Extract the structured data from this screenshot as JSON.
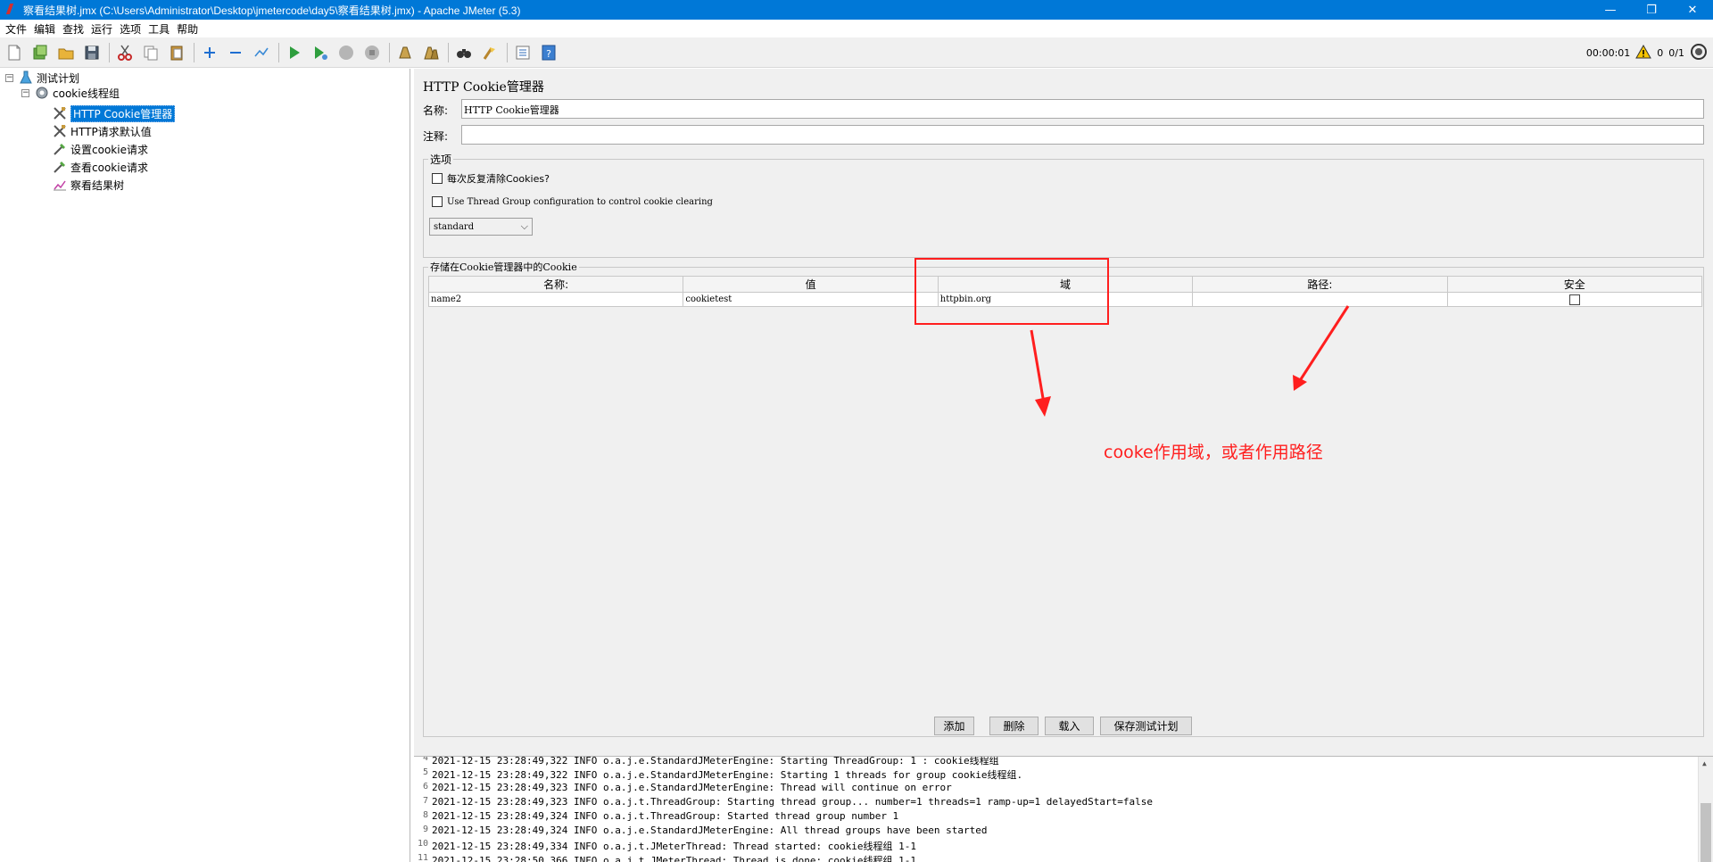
{
  "window": {
    "title": "察看结果树.jmx (C:\\Users\\Administrator\\Desktop\\jmetercode\\day5\\察看结果树.jmx) - Apache JMeter (5.3)",
    "minimize": "—",
    "maximize": "❐",
    "close": "✕"
  },
  "menu": [
    "文件",
    "编辑",
    "查找",
    "运行",
    "选项",
    "工具",
    "帮助"
  ],
  "status": {
    "elapsed": "00:00:01",
    "warnings": "0",
    "threads": "0/1"
  },
  "tree": {
    "root": "测试计划",
    "thread_group": "cookie线程组",
    "children": [
      "HTTP Cookie管理器",
      "HTTP请求默认值",
      "设置cookie请求",
      "查看cookie请求",
      "察看结果树"
    ]
  },
  "panel": {
    "title": "HTTP Cookie管理器",
    "name_label": "名称:",
    "name_value": "HTTP Cookie管理器",
    "comment_label": "注释:",
    "comment_value": "",
    "options_title": "选项",
    "clear_each_iteration": "每次反复清除Cookies?",
    "use_thread_group": "Use Thread Group configuration to control cookie clearing",
    "cookie_policy": "standard",
    "stored_title": "存储在Cookie管理器中的Cookie",
    "table": {
      "headers": [
        "名称:",
        "值",
        "域",
        "路径:",
        "安全"
      ],
      "rows": [
        {
          "name": "name2",
          "value": "cookietest",
          "domain": "httpbin.org",
          "path": "",
          "secure": false
        }
      ]
    },
    "buttons": {
      "add": "添加",
      "delete": "删除",
      "load": "载入",
      "save": "保存测试计划"
    }
  },
  "annotation": {
    "text": "cooke作用域，或者作用路径",
    "color": "#ff1e1e"
  },
  "log": [
    {
      "num": "4",
      "text": "2021-12-15 23:28:49,322 INFO o.a.j.e.StandardJMeterEngine: Starting ThreadGroup: 1 : cookie线程组"
    },
    {
      "num": "5",
      "text": "2021-12-15 23:28:49,322 INFO o.a.j.e.StandardJMeterEngine: Starting 1 threads for group cookie线程组."
    },
    {
      "num": "6",
      "text": "2021-12-15 23:28:49,323 INFO o.a.j.e.StandardJMeterEngine: Thread will continue on error"
    },
    {
      "num": "7",
      "text": "2021-12-15 23:28:49,323 INFO o.a.j.t.ThreadGroup: Starting thread group... number=1 threads=1 ramp-up=1 delayedStart=false"
    },
    {
      "num": "8",
      "text": "2021-12-15 23:28:49,324 INFO o.a.j.t.ThreadGroup: Started thread group number 1"
    },
    {
      "num": "9",
      "text": "2021-12-15 23:28:49,324 INFO o.a.j.e.StandardJMeterEngine: All thread groups have been started"
    },
    {
      "num": "10",
      "text": "2021-12-15 23:28:49,334 INFO o.a.j.t.JMeterThread: Thread started: cookie线程组 1-1"
    },
    {
      "num": "11",
      "text": "2021-12-15 23:28:50,366 INFO o.a.j.t.JMeterThread: Thread is done: cookie线程组 1-1"
    }
  ]
}
